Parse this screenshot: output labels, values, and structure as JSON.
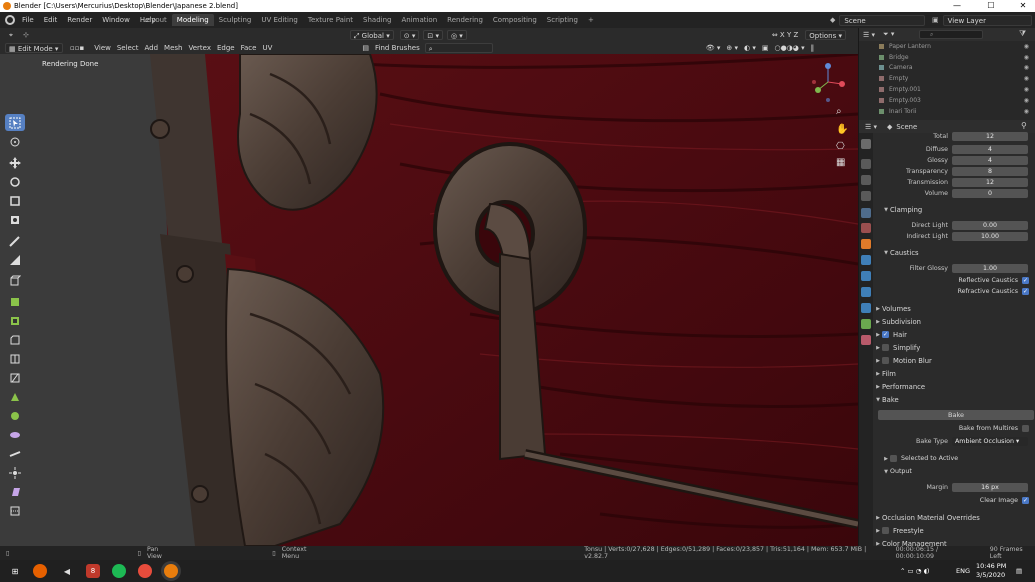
{
  "window": {
    "title": "Blender [C:\\Users\\Mercurius\\Desktop\\Blender\\Japanese 2.blend]",
    "minimize": "—",
    "maximize": "☐",
    "close": "✕"
  },
  "menu": {
    "items": [
      "File",
      "Edit",
      "Render",
      "Window",
      "Help"
    ]
  },
  "workspaces": {
    "tabs": [
      "Layout",
      "Modeling",
      "Sculpting",
      "UV Editing",
      "Texture Paint",
      "Shading",
      "Animation",
      "Rendering",
      "Compositing",
      "Scripting"
    ],
    "active": "Modeling",
    "add": "+"
  },
  "scene_selector": {
    "value": "Scene"
  },
  "view_layer_selector": {
    "value": "View Layer"
  },
  "viewport_header": {
    "orientation": "Global",
    "options_label": "Options",
    "find_brushes": "Find Brushes",
    "mode": "Edit Mode",
    "menus": [
      "View",
      "Select",
      "Add",
      "Mesh",
      "Vertex",
      "Edge",
      "Face",
      "UV"
    ]
  },
  "viewport": {
    "message": "Rendering Done",
    "accent": "#5680c2"
  },
  "outliner": {
    "items": [
      {
        "name": "Paper Lantern",
        "color": "#8a7b5a"
      },
      {
        "name": "Bridge",
        "color": "#6c8f6c"
      },
      {
        "name": "Camera",
        "color": "#6c8f8f"
      },
      {
        "name": "Empty",
        "color": "#8f6c6c"
      },
      {
        "name": "Empty.001",
        "color": "#8f6c6c"
      },
      {
        "name": "Empty.003",
        "color": "#8f6c6c"
      },
      {
        "name": "Inari Torii",
        "color": "#6c8f6c"
      }
    ]
  },
  "properties": {
    "context": "Scene",
    "light_paths": [
      {
        "label": "Total",
        "value": "12"
      },
      {
        "label": "Diffuse",
        "value": "4"
      },
      {
        "label": "Glossy",
        "value": "4"
      },
      {
        "label": "Transparency",
        "value": "8"
      },
      {
        "label": "Transmission",
        "value": "12"
      },
      {
        "label": "Volume",
        "value": "0"
      }
    ],
    "clamping": {
      "title": "Clamping",
      "rows": [
        {
          "label": "Direct Light",
          "value": "0.00"
        },
        {
          "label": "Indirect Light",
          "value": "10.00"
        }
      ]
    },
    "caustics": {
      "title": "Caustics",
      "filter_glossy": {
        "label": "Filter Glossy",
        "value": "1.00"
      },
      "reflective": "Reflective Caustics",
      "refractive": "Refractive Caustics"
    },
    "panels": [
      {
        "title": "Volumes",
        "checkbox": false
      },
      {
        "title": "Subdivision",
        "checkbox": false
      },
      {
        "title": "Hair",
        "checkbox": true,
        "checked": true
      },
      {
        "title": "Simplify",
        "checkbox": true,
        "checked": false
      },
      {
        "title": "Motion Blur",
        "checkbox": true,
        "checked": false
      },
      {
        "title": "Film",
        "checkbox": false
      },
      {
        "title": "Performance",
        "checkbox": false
      }
    ],
    "bake": {
      "title": "Bake",
      "button": "Bake",
      "bake_from_multires": "Bake from Multires",
      "bake_type_label": "Bake Type",
      "bake_type_value": "Ambient Occlusion",
      "selected_to_active": "Selected to Active",
      "output_title": "Output",
      "margin_label": "Margin",
      "margin_value": "16 px",
      "clear_image": "Clear Image"
    },
    "bottom_panels": [
      {
        "title": "Occlusion Material Overrides",
        "checkbox": false
      },
      {
        "title": "Freestyle",
        "checkbox": true,
        "checked": false
      },
      {
        "title": "Color Management",
        "checkbox": false
      }
    ]
  },
  "statusbar": {
    "pan_view": "Pan View",
    "context_menu": "Context Menu",
    "stats": "Tonsu | Verts:0/27,628 | Edges:0/51,289 | Faces:0/23,857 | Tris:51,164 | Mem: 653.7 MiB | v2.82.7",
    "time": "00:00:06:15 / 00:00:10:09",
    "frames_left": "90 Frames Left"
  },
  "taskbar": {
    "lang": "ENG",
    "clock_time": "10:46 PM",
    "clock_date": "3/5/2020",
    "badge": "8"
  }
}
